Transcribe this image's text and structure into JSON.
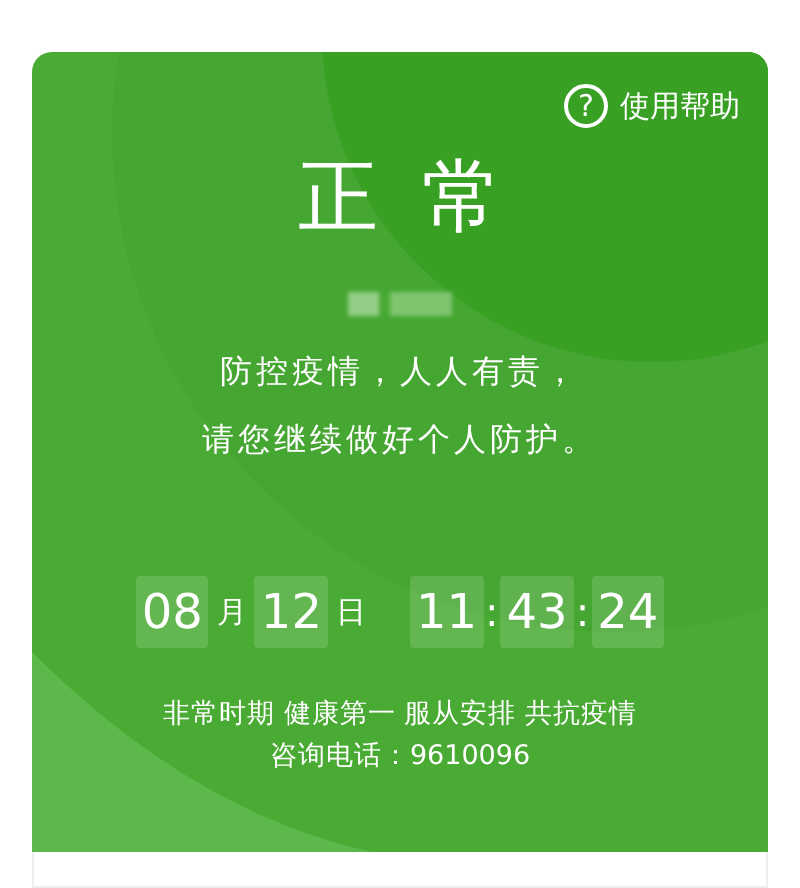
{
  "help": {
    "icon_text": "?",
    "label": "使用帮助"
  },
  "status": "正常",
  "message": [
    "防控疫情，人人有责，",
    "请您继续做好个人防护。"
  ],
  "clock": [
    {
      "kind": "box",
      "text": "08"
    },
    {
      "kind": "unit",
      "text": "月"
    },
    {
      "kind": "box",
      "text": "12"
    },
    {
      "kind": "unit",
      "text": "日"
    },
    {
      "kind": "gap"
    },
    {
      "kind": "box",
      "text": "11"
    },
    {
      "kind": "sep",
      "text": ":"
    },
    {
      "kind": "box",
      "text": "43"
    },
    {
      "kind": "sep",
      "text": ":"
    },
    {
      "kind": "box",
      "text": "24"
    }
  ],
  "footer": [
    "非常时期 健康第一 服从安排 共抗疫情",
    "咨询电话：9610096"
  ]
}
